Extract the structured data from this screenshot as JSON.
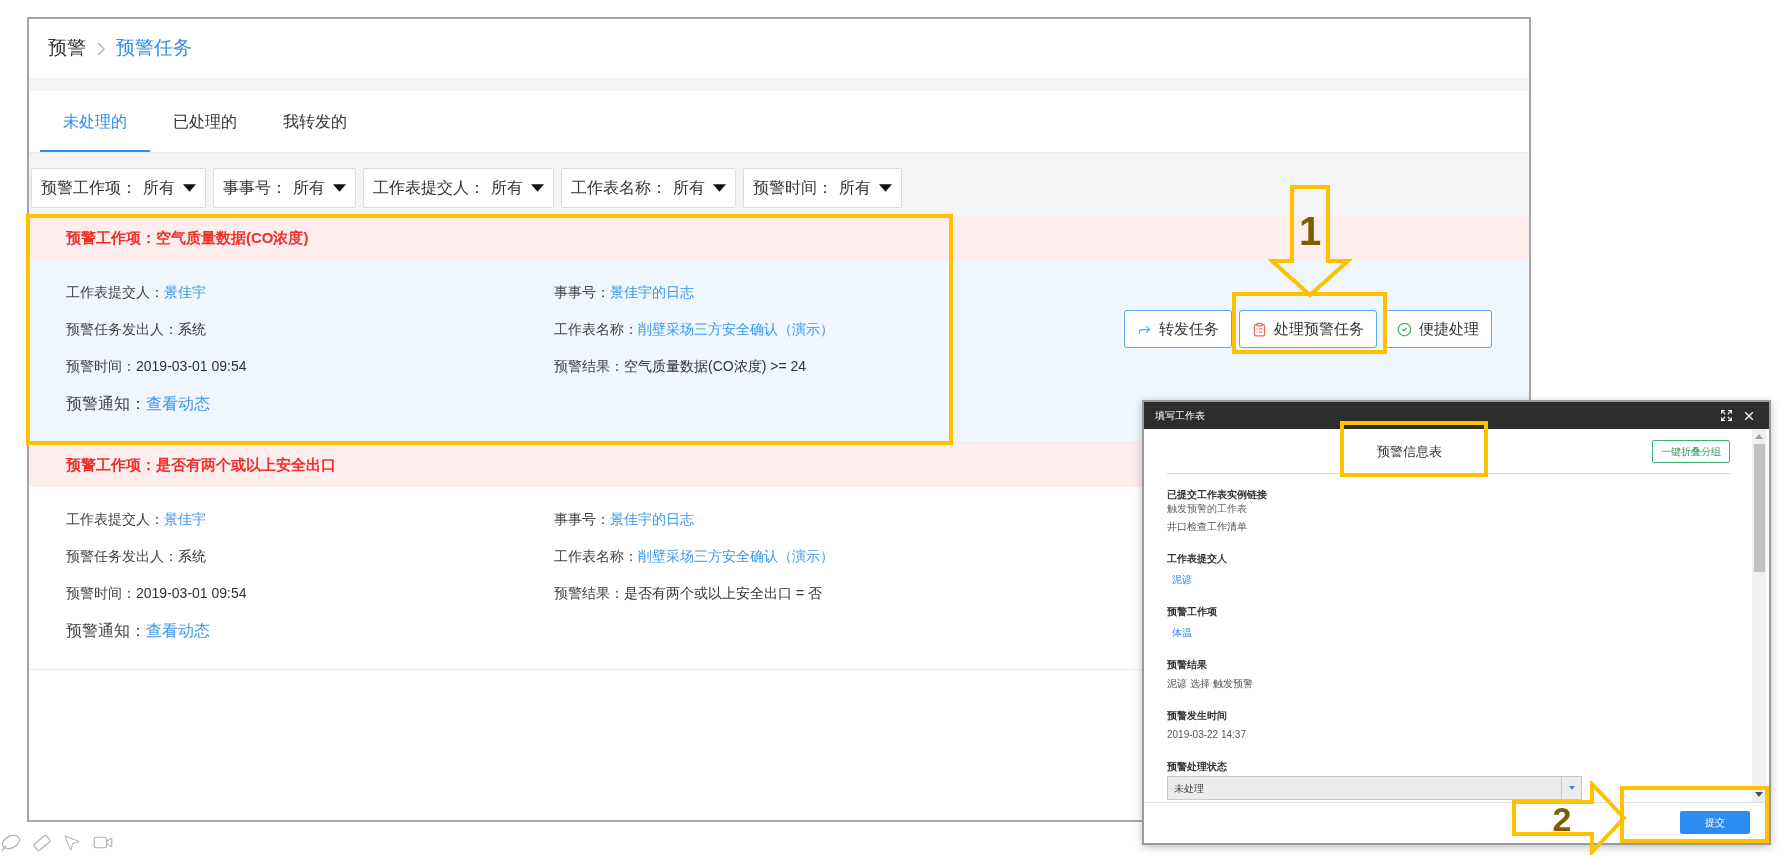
{
  "breadcrumb": [
    {
      "label": "预警",
      "current": false
    },
    {
      "label": "预警任务",
      "current": true
    }
  ],
  "tabs": [
    {
      "label": "未处理的",
      "selected": true
    },
    {
      "label": "已处理的",
      "selected": false
    },
    {
      "label": "我转发的",
      "selected": false
    }
  ],
  "filters": [
    {
      "label": "预警工作项：",
      "value": "所有"
    },
    {
      "label": "事事号：",
      "value": "所有"
    },
    {
      "label": "工作表提交人：",
      "value": "所有"
    },
    {
      "label": "工作表名称：",
      "value": "所有"
    },
    {
      "label": "预警时间：",
      "value": "所有"
    }
  ],
  "alerts": [
    {
      "title": "预警工作项：空气质量数据(CO浓度)",
      "selected": true,
      "fields": [
        {
          "label": "工作表提交人：",
          "value": "景佳宇",
          "kind": "link"
        },
        {
          "label": "事事号：",
          "value": "景佳宇的日志",
          "kind": "link"
        },
        {
          "label": "预警任务发出人：",
          "value": "系统",
          "kind": "text"
        },
        {
          "label": "工作表名称：",
          "value": "削壁采场三方安全确认（演示）",
          "kind": "link"
        },
        {
          "label": "预警时间：",
          "value": "2019-03-01 09:54",
          "kind": "text"
        },
        {
          "label": "预警结果：",
          "value": "空气质量数据(CO浓度) >= 24",
          "kind": "text"
        },
        {
          "label": "预警通知：",
          "value": "查看动态",
          "kind": "notice"
        }
      ],
      "actions": [
        {
          "label": "转发任务",
          "kind": "forward"
        },
        {
          "label": "处理预警任务",
          "kind": "process"
        },
        {
          "label": "便捷处理",
          "kind": "quick"
        }
      ]
    },
    {
      "title": "预警工作项：是否有两个或以上安全出口",
      "selected": false,
      "fields": [
        {
          "label": "工作表提交人：",
          "value": "景佳宇",
          "kind": "link"
        },
        {
          "label": "事事号：",
          "value": "景佳宇的日志",
          "kind": "link"
        },
        {
          "label": "预警任务发出人：",
          "value": "系统",
          "kind": "text"
        },
        {
          "label": "工作表名称：",
          "value": "削壁采场三方安全确认（演示）",
          "kind": "link"
        },
        {
          "label": "预警时间：",
          "value": "2019-03-01 09:54",
          "kind": "text"
        },
        {
          "label": "预警结果：",
          "value": "是否有两个或以上安全出口 = 否",
          "kind": "text"
        },
        {
          "label": "预警通知：",
          "value": "查看动态",
          "kind": "notice"
        }
      ]
    }
  ],
  "dialog": {
    "title": "填写工作表",
    "heading": "预警信息表",
    "collapse_button": "一键折叠分组",
    "sections": [
      {
        "label": "已提交工作表实例链接",
        "description": "触发预警的工作表",
        "kind": "text",
        "value": "井口检查工作清单"
      },
      {
        "label": "工作表提交人",
        "kind": "link",
        "value": "泥谚"
      },
      {
        "label": "预警工作项",
        "kind": "link",
        "value": "体温"
      },
      {
        "label": "预警结果",
        "kind": "text",
        "value": "泥谚 选择 触发预警"
      },
      {
        "label": "预警发生时间",
        "kind": "text",
        "value": "2019-03-22 14:37"
      },
      {
        "label": "预警处理状态",
        "kind": "select",
        "value": "未处理"
      }
    ],
    "submit": "提交"
  },
  "callouts": [
    {
      "number": "1",
      "kind": "down"
    },
    {
      "number": "2",
      "kind": "right"
    }
  ]
}
